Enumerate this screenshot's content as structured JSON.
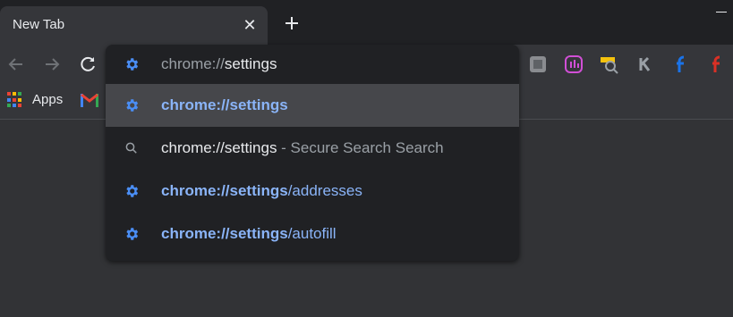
{
  "tab": {
    "title": "New Tab",
    "close_icon": "close-icon"
  },
  "bookmarks": {
    "apps_label": "Apps"
  },
  "omnibox": {
    "prefix": "chrome://",
    "typed": "settings"
  },
  "suggestions": [
    {
      "icon": "gear-icon",
      "bold": "chrome://settings",
      "rest": "",
      "selected": true
    },
    {
      "icon": "search-icon",
      "bold": "chrome://settings",
      "rest": " - Secure Search Search",
      "selected": false
    },
    {
      "icon": "gear-icon",
      "bold": "chrome://settings",
      "rest": "/addresses",
      "selected": false
    },
    {
      "icon": "gear-icon",
      "bold": "chrome://settings",
      "rest": "/autofill",
      "selected": false
    }
  ],
  "colors": {
    "tabstrip": "#202124",
    "toolbar": "#35363a",
    "dropdown": "#202124",
    "selected_row": "#46474b",
    "link_blue": "#8ab4f8",
    "gear_blue": "#4a8ef5"
  }
}
